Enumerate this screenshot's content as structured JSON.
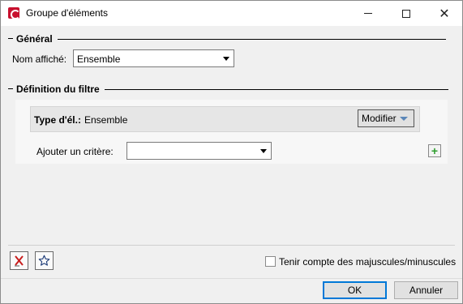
{
  "window": {
    "title": "Groupe d'éléments"
  },
  "general": {
    "heading": "Général",
    "display_name_label": "Nom affiché:",
    "display_name_value": "Ensemble"
  },
  "filter": {
    "heading": "Définition du filtre",
    "type_label": "Type d'él.:",
    "type_value": "Ensemble",
    "modify_label": "Modifier",
    "add_criterion_label": "Ajouter un critère:",
    "add_criterion_value": ""
  },
  "options": {
    "case_sensitive_label": "Tenir compte des majuscules/minuscules",
    "case_sensitive_checked": false
  },
  "buttons": {
    "ok": "OK",
    "cancel": "Annuler"
  }
}
